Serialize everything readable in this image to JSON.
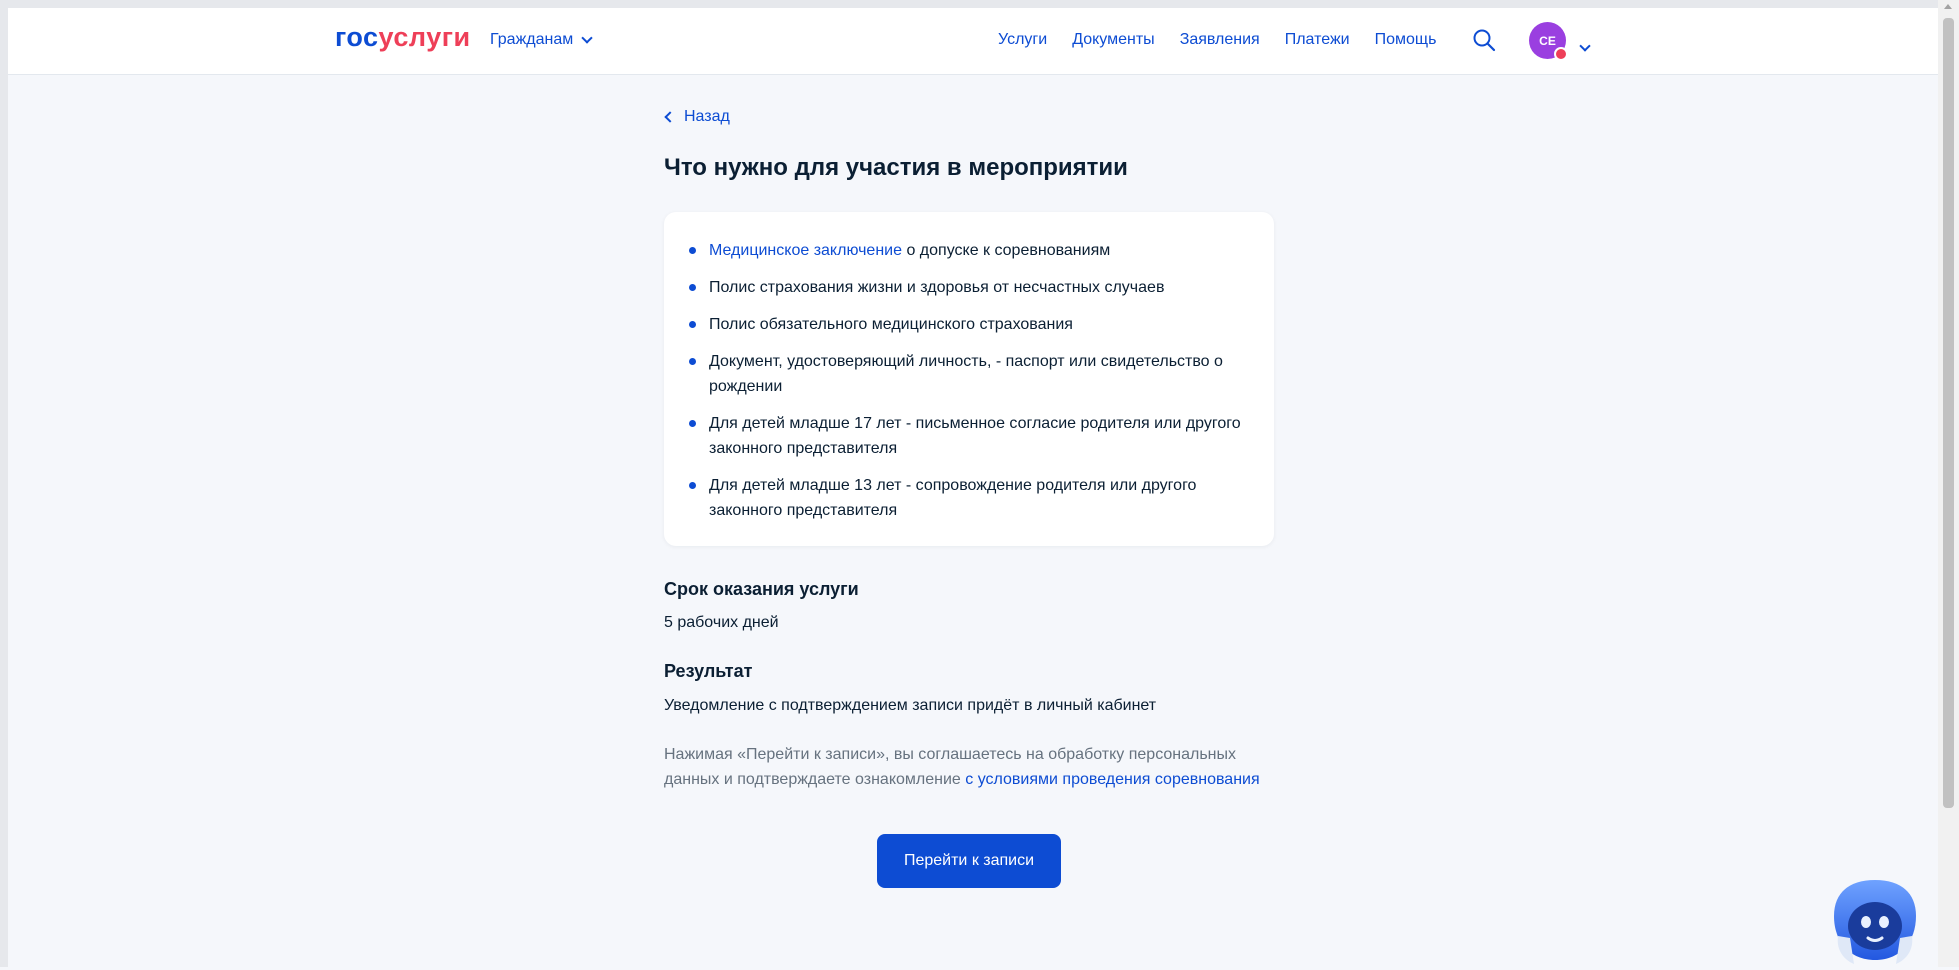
{
  "header": {
    "logo_part1": "гос",
    "logo_part2": "услуги",
    "citizens_label": "Гражданам",
    "nav": [
      "Услуги",
      "Документы",
      "Заявления",
      "Платежи",
      "Помощь"
    ],
    "avatar_initials": "СЕ",
    "search_icon": "search-icon"
  },
  "main": {
    "back_label": "Назад",
    "title": "Что нужно для участия в мероприятии",
    "requirements": [
      {
        "link": "Медицинское заключение",
        "text": " о допуске к соревнованиям"
      },
      {
        "link": "",
        "text": "Полис страхования жизни и здоровья от несчастных случаев"
      },
      {
        "link": "",
        "text": "Полис обязательного медицинского страхования"
      },
      {
        "link": "",
        "text": "Документ, удостоверяющий личность,  -  паспорт или свидетельство о рождении"
      },
      {
        "link": "",
        "text": "Для детей младше 17 лет - письменное согласие родителя или другого законного представителя"
      },
      {
        "link": "",
        "text": "Для детей младше 13 лет - сопровождение родителя или другого законного представителя"
      }
    ],
    "term_title": "Срок оказания услуги",
    "term_value": "5 рабочих дней",
    "result_title": "Результат",
    "result_value": "Уведомление с подтверждением записи придёт в личный кабинет",
    "consent_text": "Нажимая «Перейти к записи», вы соглашаетесь на обработку персональных данных и подтверждаете ознакомление ",
    "consent_link": "с условиями проведения соревнования",
    "submit_label": "Перейти к записи"
  },
  "colors": {
    "accent": "#0d4cd3",
    "brand_red": "#ee3f58",
    "avatar": "#9a3fe0",
    "background": "#f5f7fb"
  }
}
